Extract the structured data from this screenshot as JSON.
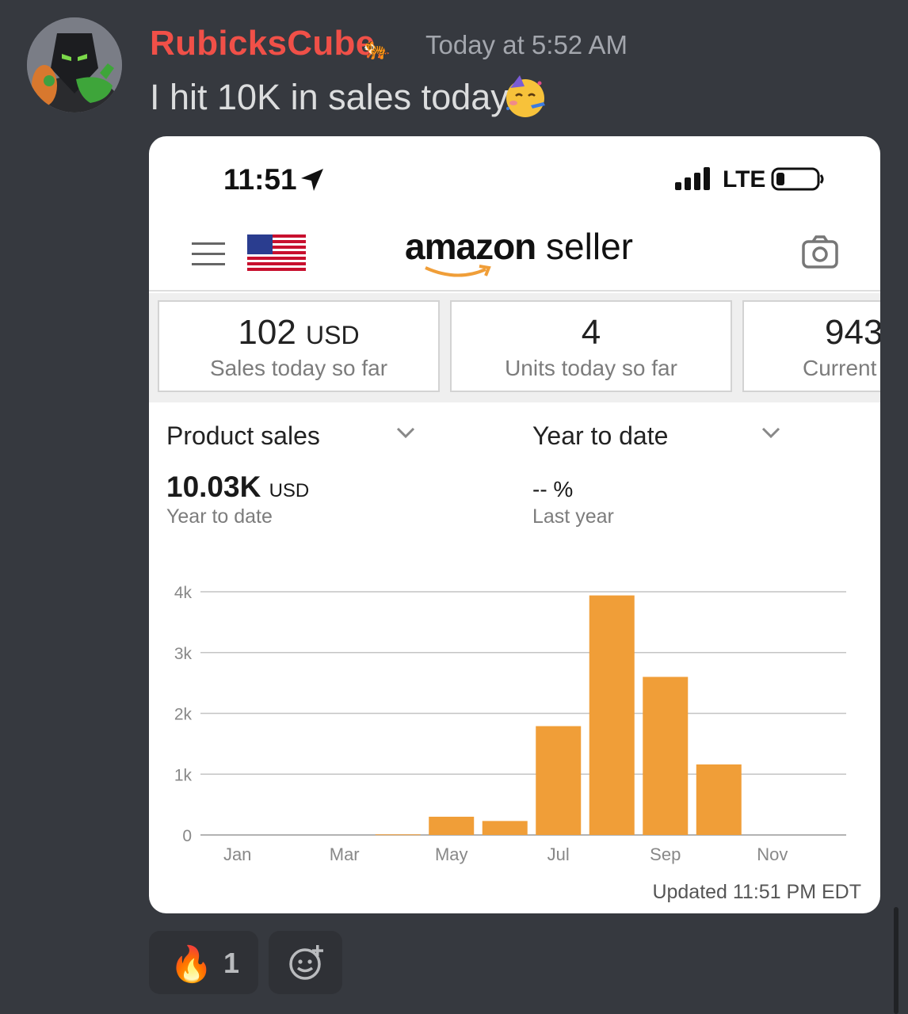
{
  "message": {
    "username": "RubicksCube",
    "username_color": "#f05048",
    "badge_icon": "tiger-icon",
    "timestamp": "Today at 5:52 AM",
    "text": "I hit 10K in sales today",
    "text_emoji": "partying-face-icon"
  },
  "phone_status": {
    "time": "11:51",
    "network": "LTE"
  },
  "app": {
    "logo_brand": "amazon",
    "logo_suffix": "seller"
  },
  "tiles": [
    {
      "value": "102",
      "unit": "USD",
      "label": "Sales today so far"
    },
    {
      "value": "4",
      "unit": "",
      "label": "Units today so far"
    },
    {
      "value": "943",
      "unit": "",
      "label": "Current"
    }
  ],
  "selectors": {
    "metric": "Product sales",
    "period": "Year to date"
  },
  "summary": {
    "value": "10.03K",
    "unit": "USD",
    "value_label": "Year to date",
    "pct": "-- %",
    "pct_label": "Last year"
  },
  "chart_data": {
    "type": "bar",
    "categories": [
      "Jan",
      "Feb",
      "Mar",
      "Apr",
      "May",
      "Jun",
      "Jul",
      "Aug",
      "Sep",
      "Oct",
      "Nov",
      "Dec"
    ],
    "values": [
      0,
      0,
      0,
      10,
      300,
      230,
      1790,
      3940,
      2600,
      1160,
      0,
      0
    ],
    "x_tick_labels": [
      "Jan",
      "Mar",
      "May",
      "Jul",
      "Sep",
      "Nov"
    ],
    "y_tick_labels": [
      "4k",
      "3k",
      "2k",
      "1k",
      "0"
    ],
    "y_ticks": [
      4000,
      3000,
      2000,
      1000,
      0
    ],
    "ylim": [
      0,
      4000
    ],
    "bar_color": "#f09e38",
    "grid": true
  },
  "updated": "Updated 11:51 PM EDT",
  "reactions": [
    {
      "emoji": "fire-icon",
      "count": "1"
    }
  ]
}
